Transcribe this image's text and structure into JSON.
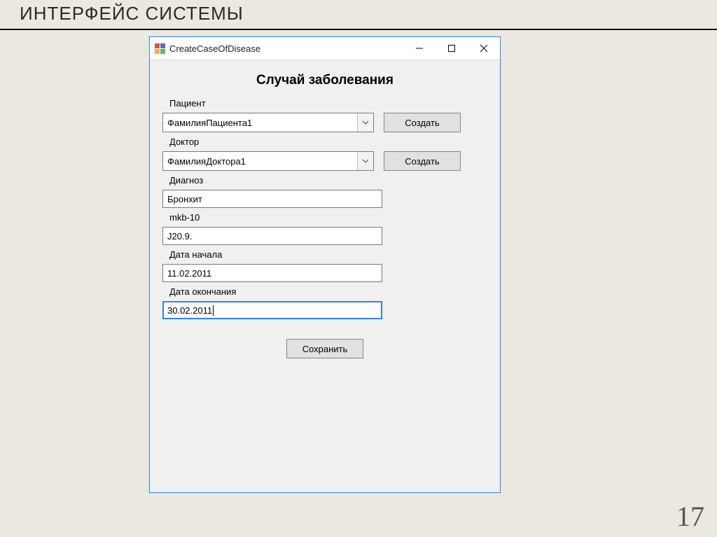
{
  "slide": {
    "title": "ИНТЕРФЕЙС СИСТЕМЫ",
    "page_number": "17"
  },
  "window": {
    "title": "CreateCaseOfDisease",
    "form_title": "Случай заболевания",
    "labels": {
      "patient": "Пациент",
      "doctor": "Доктор",
      "diagnosis": "Диагноз",
      "mkb": "mkb-10",
      "date_start": "Дата начала",
      "date_end": "Дата окончания"
    },
    "values": {
      "patient": "ФамилияПациента1",
      "doctor": "ФамилияДоктора1",
      "diagnosis": "Бронхит",
      "mkb": "J20.9.",
      "date_start": "11.02.2011",
      "date_end": "30.02.2011"
    },
    "buttons": {
      "create": "Создать",
      "save": "Сохранить"
    }
  }
}
